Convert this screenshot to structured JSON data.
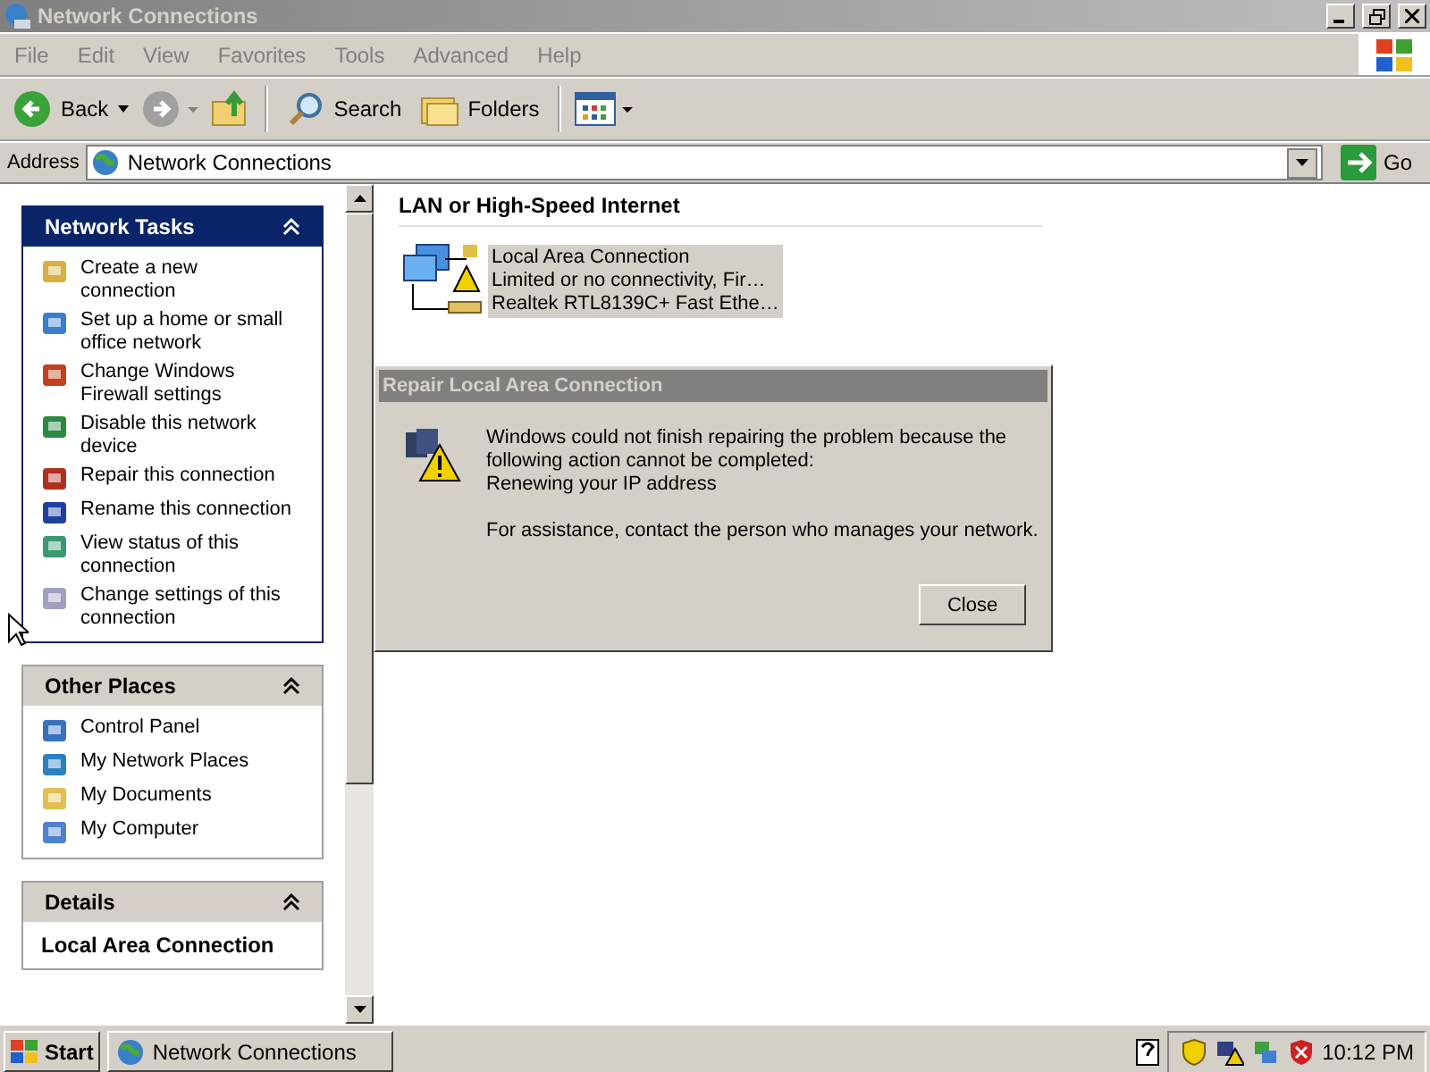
{
  "window": {
    "title": "Network Connections"
  },
  "menu": [
    "File",
    "Edit",
    "View",
    "Favorites",
    "Tools",
    "Advanced",
    "Help"
  ],
  "toolbar": {
    "back": "Back",
    "search": "Search",
    "folders": "Folders"
  },
  "address": {
    "label": "Address",
    "value": "Network Connections",
    "go": "Go"
  },
  "sidebar": [
    {
      "title": "Network Tasks",
      "kind": "primary",
      "items": [
        "Create a new connection",
        "Set up a home or small office network",
        "Change Windows Firewall settings",
        "Disable this network device",
        "Repair this connection",
        "Rename this connection",
        "View status of this connection",
        "Change settings of this connection"
      ]
    },
    {
      "title": "Other Places",
      "kind": "normal",
      "items": [
        "Control Panel",
        "My Network Places",
        "My Documents",
        "My Computer"
      ]
    },
    {
      "title": "Details",
      "kind": "details",
      "items": [
        "Local Area Connection"
      ]
    }
  ],
  "content": {
    "group": "LAN or High-Speed Internet",
    "connection": {
      "name": "Local Area Connection",
      "status": "Limited or no connectivity, Fir…",
      "device": "Realtek RTL8139C+ Fast Ethe…",
      "selected": true
    }
  },
  "dialog": {
    "title": "Repair Local Area Connection",
    "message": [
      "Windows could not finish repairing the problem because the",
      "following action cannot be completed:",
      "Renewing your IP address"
    ],
    "note": "For assistance, contact the person who manages your network.",
    "button": "Close"
  },
  "taskbar": {
    "start": "Start",
    "task": "Network Connections",
    "clock": "10:12 PM"
  }
}
